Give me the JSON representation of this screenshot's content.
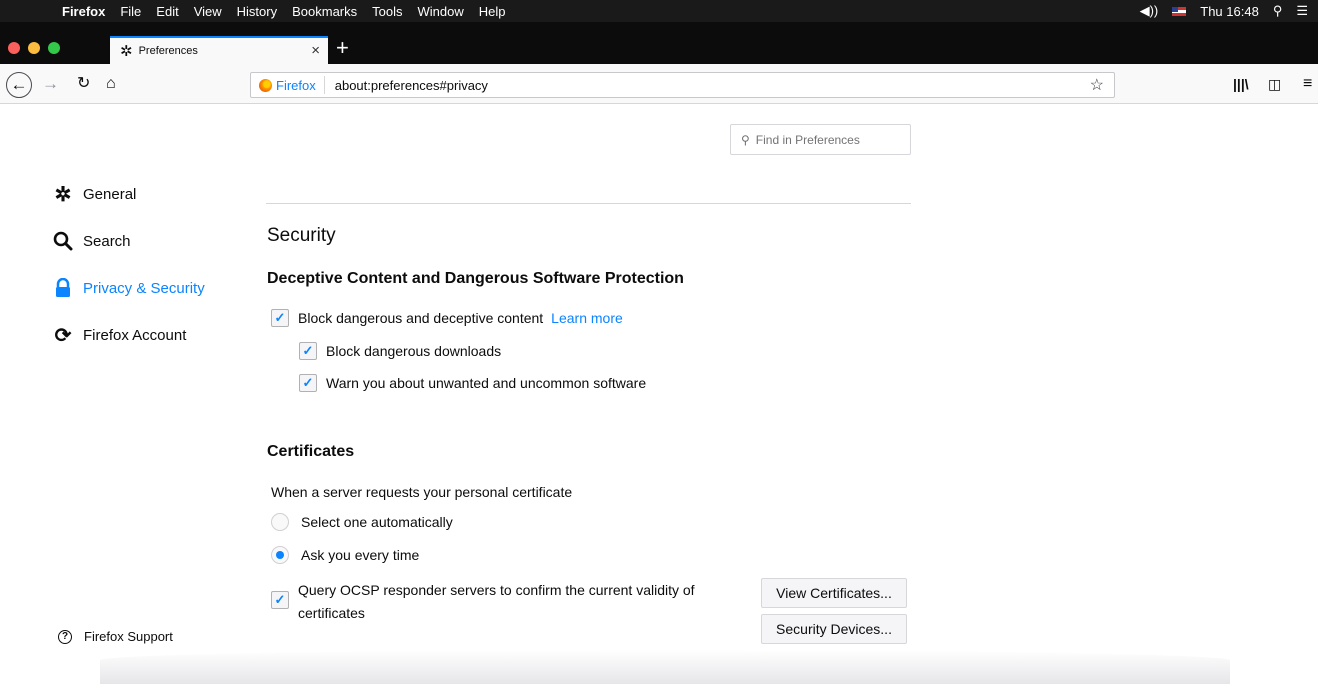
{
  "menubar": {
    "apple": "",
    "items": [
      "Firefox",
      "File",
      "Edit",
      "View",
      "History",
      "Bookmarks",
      "Tools",
      "Window",
      "Help"
    ],
    "clock": "Thu 16:48"
  },
  "tabs": {
    "active_title": "Preferences",
    "close_symbol": "×",
    "new_tab_symbol": "+"
  },
  "toolbar": {
    "identity_label": "Firefox",
    "url": "about:preferences#privacy"
  },
  "sidebar": {
    "items": [
      {
        "label": "General",
        "icon": "gear-icon"
      },
      {
        "label": "Search",
        "icon": "search-icon"
      },
      {
        "label": "Privacy & Security",
        "icon": "lock-icon"
      },
      {
        "label": "Firefox Account",
        "icon": "sync-icon"
      }
    ],
    "selected": "Privacy & Security",
    "support_label": "Firefox Support"
  },
  "search": {
    "placeholder": "Find in Preferences"
  },
  "security": {
    "title": "Security",
    "deceptive_heading": "Deceptive Content and Dangerous Software Protection",
    "block_deceptive": {
      "label": "Block dangerous and deceptive content",
      "checked": true
    },
    "learn_more": "Learn more",
    "block_downloads": {
      "label": "Block dangerous downloads",
      "checked": true
    },
    "warn_unwanted": {
      "label": "Warn you about unwanted and uncommon software",
      "checked": true
    }
  },
  "certificates": {
    "heading": "Certificates",
    "prompt": "When a server requests your personal certificate",
    "option_auto": {
      "label": "Select one automatically",
      "selected": false
    },
    "option_ask": {
      "label": "Ask you every time",
      "selected": true
    },
    "ocsp": {
      "label_line1": "Query OCSP responder servers to confirm the current validity of",
      "label_line2": "certificates",
      "checked": true
    },
    "view_button": "View Certificates...",
    "devices_button": "Security Devices..."
  },
  "colors": {
    "accent": "#0a84ff",
    "tabstrip": "#0c0c0d",
    "toolbar": "#f9f9fa"
  }
}
